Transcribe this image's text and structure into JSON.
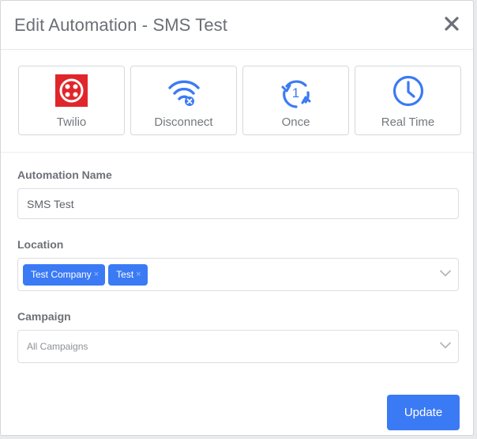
{
  "modal": {
    "title": "Edit Automation - SMS Test",
    "close_icon": "close-icon"
  },
  "cards": [
    {
      "label": "Twilio",
      "icon": "twilio-logo-icon"
    },
    {
      "label": "Disconnect",
      "icon": "wifi-disconnect-icon"
    },
    {
      "label": "Once",
      "icon": "repeat-once-icon",
      "badge": "1"
    },
    {
      "label": "Real Time",
      "icon": "clock-icon"
    }
  ],
  "form": {
    "automation_name": {
      "label": "Automation Name",
      "value": "SMS Test"
    },
    "location": {
      "label": "Location",
      "tags": [
        "Test Company",
        "Test"
      ],
      "remove_glyph": "×"
    },
    "campaign": {
      "label": "Campaign",
      "selected": "All Campaigns"
    }
  },
  "actions": {
    "update_label": "Update"
  },
  "colors": {
    "accent": "#3b7af5",
    "twilio_red": "#e0262b",
    "icon_blue": "#3b7af5"
  }
}
